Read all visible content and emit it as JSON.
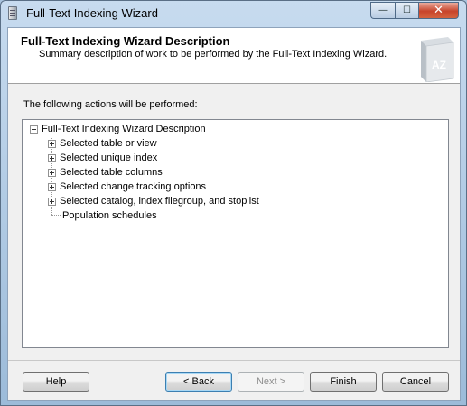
{
  "window": {
    "title": "Full-Text Indexing Wizard",
    "caption_minimize": "—",
    "caption_maximize": "☐",
    "caption_close": "✕"
  },
  "header": {
    "title": "Full-Text Indexing Wizard Description",
    "subtitle": "Summary description of work to be performed by the Full-Text Indexing Wizard.",
    "art_label": "AZ"
  },
  "main": {
    "section_label": "The following actions will be performed:",
    "tree": {
      "root": {
        "label": "Full-Text Indexing Wizard Description",
        "expanded": true
      },
      "children": [
        {
          "label": "Selected table or view",
          "expandable": true
        },
        {
          "label": "Selected unique index",
          "expandable": true
        },
        {
          "label": "Selected table columns",
          "expandable": true
        },
        {
          "label": "Selected change tracking options",
          "expandable": true
        },
        {
          "label": "Selected catalog, index filegroup, and stoplist",
          "expandable": true
        },
        {
          "label": "Population schedules",
          "expandable": false
        }
      ]
    }
  },
  "footer": {
    "help": "Help",
    "back": "< Back",
    "next": "Next >",
    "finish": "Finish",
    "cancel": "Cancel"
  }
}
